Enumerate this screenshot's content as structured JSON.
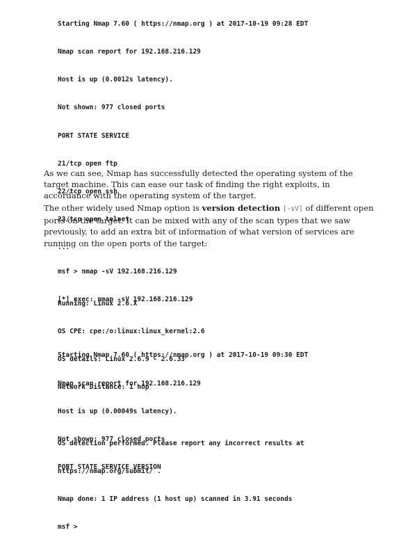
{
  "code_block_1": {
    "lines_a": [
      "Starting Nmap 7.60 ( https://nmap.org ) at 2017-10-19 09:28 EDT",
      "Nmap scan report for 192.168.216.129",
      "Host is up (0.0012s latency).",
      "Not shown: 977 closed ports",
      "PORT STATE SERVICE",
      "21/tcp open ftp",
      "22/tcp open ssh",
      "23/tcp open telnet",
      "..."
    ],
    "lines_b": [
      "Running: Linux 2.6.X",
      "OS CPE: cpe:/o:linux:linux_kernel:2.6",
      "OS details: Linux 2.6.9 - 2.6.33",
      "Network Distance: 1 hop"
    ],
    "lines_c": [
      "OS detection performed. Please report any incorrect results at",
      "https://nmap.org/submit/ .",
      "Nmap done: 1 IP address (1 host up) scanned in 3.91 seconds",
      "msf >"
    ]
  },
  "paragraph_1": "As we can see, Nmap has successfully detected the operating system of the target machine. This can ease our task of finding the right exploits, in accordance with the operating system of the target.",
  "paragraph_2": {
    "before": "The other widely used Nmap option is ",
    "bold": "version detection",
    "space": " ",
    "code": "[-sV]",
    "after": " of different open ports on the target. It can be mixed with any of the scan types that we saw previously, to add an extra bit of information of what version of services are running on the open ports of the target:"
  },
  "code_block_2": {
    "lines_a": [
      "msf > nmap -sV 192.168.216.129",
      "[*] exec: nmap -sV 192.168.216.129"
    ],
    "lines_b": [
      "Starting Nmap 7.60 ( https://nmap.org ) at 2017-10-19 09:30 EDT",
      "Nmap scan report for 192.168.216.129",
      "Host is up (0.00049s latency).",
      "Not shown: 977 closed ports",
      "PORT STATE SERVICE VERSION"
    ]
  }
}
